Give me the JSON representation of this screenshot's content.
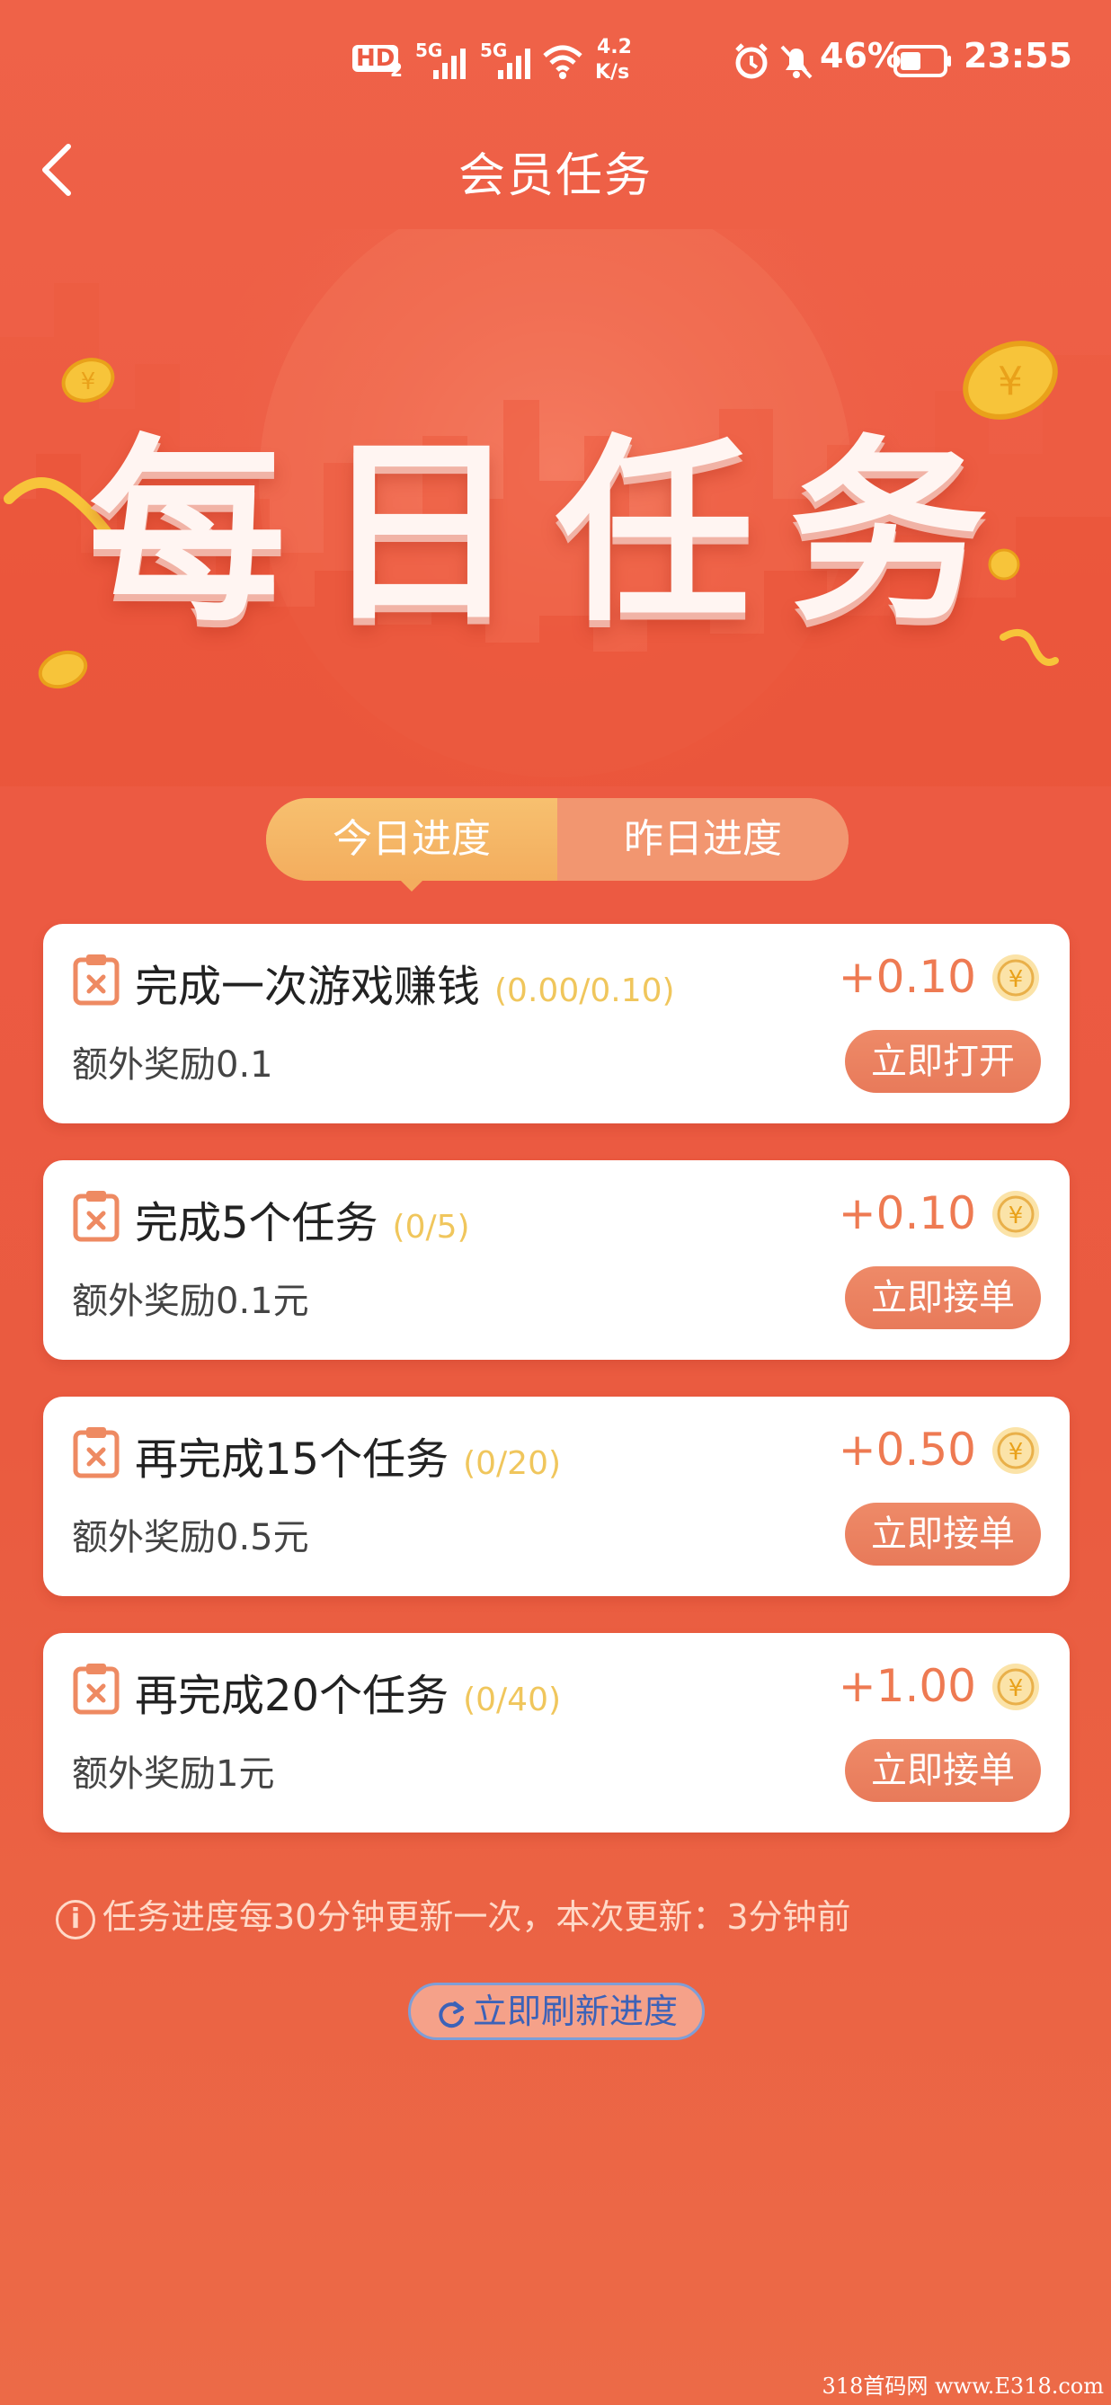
{
  "status_bar": {
    "hd": "HD",
    "hd_sub": "2",
    "net1": "5G",
    "net2": "5G",
    "speed_value": "4.2",
    "speed_unit": "K/s",
    "battery": "46%",
    "time": "23:55"
  },
  "header": {
    "title": "会员任务"
  },
  "banner": {
    "title": "每日任务"
  },
  "tabs": [
    {
      "label": "今日进度",
      "active": true
    },
    {
      "label": "昨日进度",
      "active": false
    }
  ],
  "tasks": [
    {
      "title": "完成一次游戏赚钱",
      "progress": "(0.00/0.10)",
      "reward": "+0.10",
      "extra": "额外奖励0.1",
      "button": "立即打开"
    },
    {
      "title": "完成5个任务",
      "progress": "(0/5)",
      "reward": "+0.10",
      "extra": "额外奖励0.1元",
      "button": "立即接单"
    },
    {
      "title": "再完成15个任务",
      "progress": "(0/20)",
      "reward": "+0.50",
      "extra": "额外奖励0.5元",
      "button": "立即接单"
    },
    {
      "title": "再完成20个任务",
      "progress": "(0/40)",
      "reward": "+1.00",
      "extra": "额外奖励1元",
      "button": "立即接单"
    }
  ],
  "footer": {
    "notice": "任务进度每30分钟更新一次，本次更新：3分钟前",
    "refresh_label": "立即刷新进度"
  },
  "watermark": "318首码网  www.E318.com",
  "colors": {
    "background": "#ec5a42",
    "accent": "#ee7a52",
    "progress": "#f0c65c",
    "tab_active": "#f3ad5e"
  }
}
